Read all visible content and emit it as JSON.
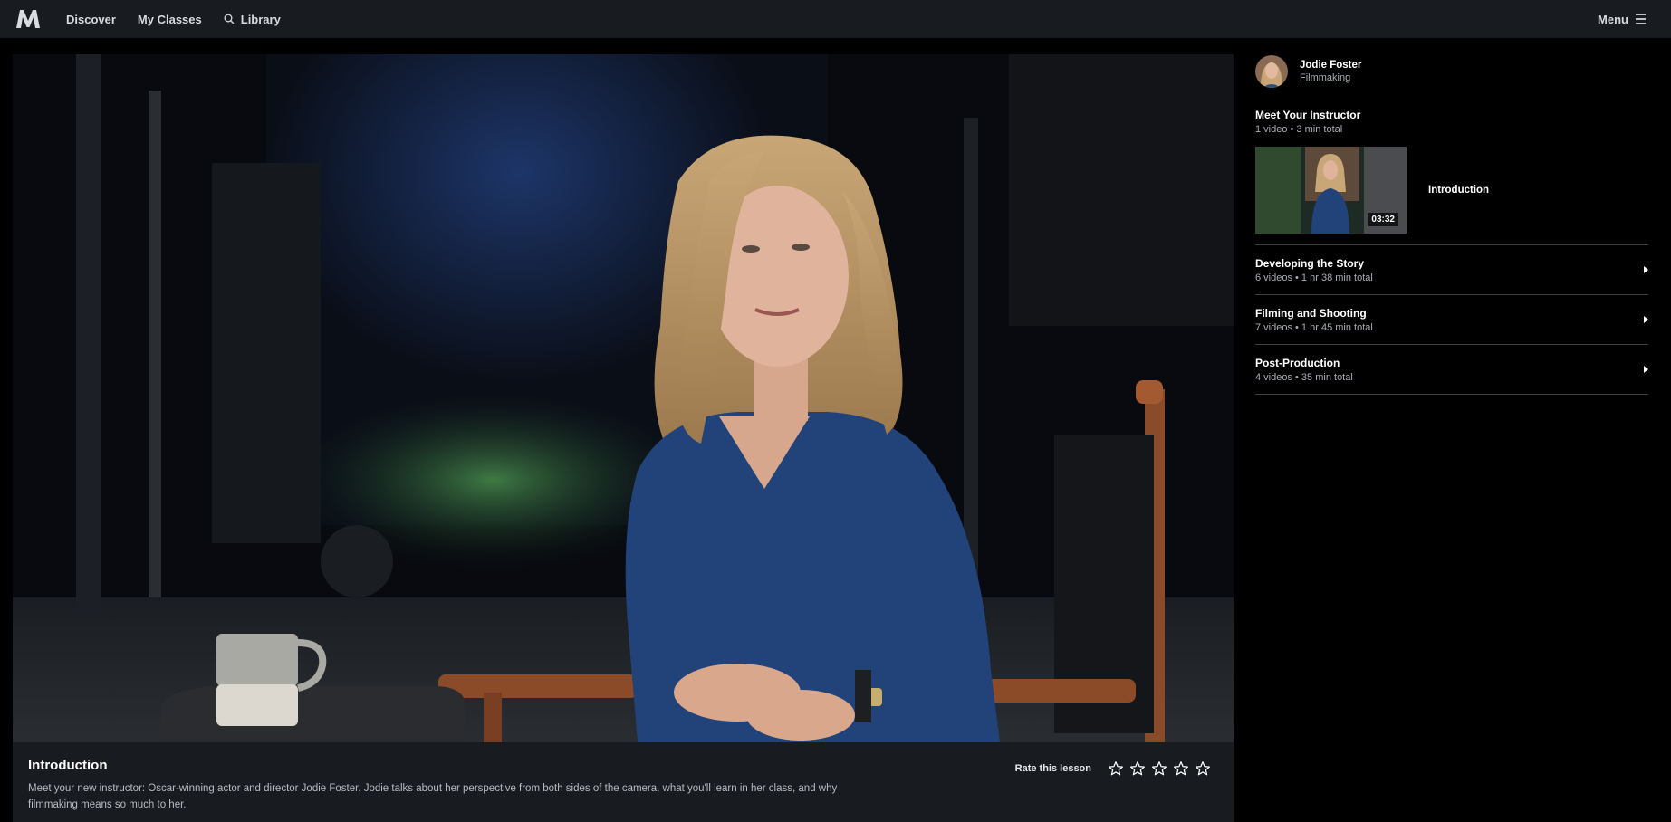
{
  "nav": {
    "logo_icon": "masterclass-logo-icon",
    "links": [
      "Discover",
      "My Classes",
      "Library"
    ],
    "menu_label": "Menu"
  },
  "instructor": {
    "name": "Jodie Foster",
    "subject": "Filmmaking"
  },
  "chapters": [
    {
      "title": "Meet Your Instructor",
      "meta": "1 video • 3 min total",
      "lessons": [
        {
          "title": "Introduction",
          "duration": "03:32"
        }
      ]
    },
    {
      "title": "Developing the Story",
      "meta": "6 videos • 1 hr 38 min total"
    },
    {
      "title": "Filming and Shooting",
      "meta": "7 videos • 1 hr 45 min total"
    },
    {
      "title": "Post-Production",
      "meta": "4 videos • 35 min total"
    }
  ],
  "lesson": {
    "title": "Introduction",
    "description": "Meet your new instructor: Oscar-winning actor and director Jodie Foster. Jodie talks about her perspective from both sides of the camera, what you'll learn in her class, and why filmmaking means so much to her.",
    "rate_label": "Rate this lesson",
    "rating": 0,
    "max_rating": 5
  },
  "colors": {
    "nav_bg": "#181b20",
    "page_bg": "#000000",
    "info_bg": "#181b20",
    "divider": "#3a3d42",
    "shirt_blue": "#22427a"
  }
}
